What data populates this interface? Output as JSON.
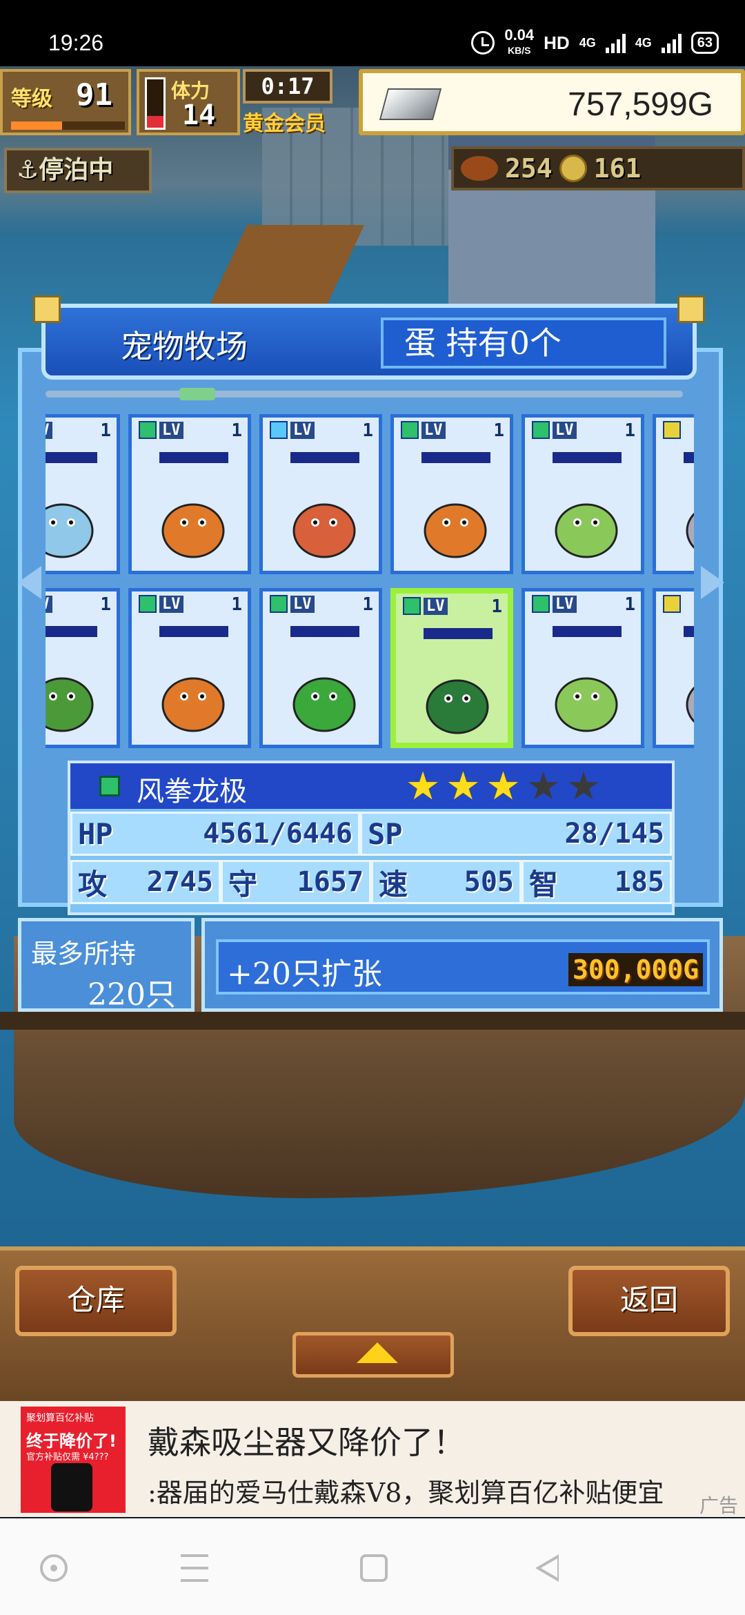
{
  "status_bar": {
    "time": "19:26",
    "net_speed": "0.04",
    "net_unit": "KB/S",
    "hd": "HD",
    "sig1": "4G",
    "sig2": "4G",
    "battery": "63"
  },
  "hud": {
    "level_label": "等级",
    "level": "91",
    "level_progress": 0.45,
    "stamina_label": "体力",
    "stamina": "14",
    "stamina_fill": 0.25,
    "timer": "0:17",
    "membership": "黄金会员",
    "gold": "757,599G",
    "status": "停泊中",
    "food": "254",
    "medals": "161",
    "icons": [
      "ingot-icon",
      "anchor-icon",
      "meat-icon",
      "coin-icon"
    ]
  },
  "pet_ranch": {
    "title": "宠物牧场",
    "eggs": "蛋 持有0个",
    "row1": [
      {
        "lv": "LV",
        "num": "1",
        "elem_color": "#4aa6e8",
        "pet": "ice-lizard-pet"
      },
      {
        "lv": "LV",
        "num": "1",
        "elem_color": "#2ec06a",
        "pet": "orange-bird-pet"
      },
      {
        "lv": "LV",
        "num": "1",
        "elem_color": "#5ac8ff",
        "pet": "octopus-pet"
      },
      {
        "lv": "LV",
        "num": "1",
        "elem_color": "#2ec06a",
        "pet": "orange-bird-pet"
      },
      {
        "lv": "LV",
        "num": "1",
        "elem_color": "#2ec06a",
        "pet": "green-frog-pet"
      },
      {
        "lv": "",
        "num": "",
        "elem_color": "#e8d23a",
        "pet": "partial-pet"
      }
    ],
    "row2": [
      {
        "lv": "LV",
        "num": "1",
        "elem_color": "#2ec06a",
        "pet": "pineapple-pet"
      },
      {
        "lv": "LV",
        "num": "1",
        "elem_color": "#2ec06a",
        "pet": "orange-bird-pet"
      },
      {
        "lv": "LV",
        "num": "1",
        "elem_color": "#2ec06a",
        "pet": "broccoli-pet"
      },
      {
        "lv": "LV",
        "num": "1",
        "elem_color": "#2ec06a",
        "pet": "wind-dragon-pet",
        "selected": true
      },
      {
        "lv": "LV",
        "num": "1",
        "elem_color": "#2ec06a",
        "pet": "green-frog-pet"
      },
      {
        "lv": "",
        "num": "",
        "elem_color": "#e8d23a",
        "pet": "partial-pet"
      }
    ]
  },
  "selected_pet": {
    "name": "风拳龙极",
    "stars": 3,
    "max_stars": 5,
    "hp_label": "HP",
    "hp": "4561/6446",
    "sp_label": "SP",
    "sp": "28/145",
    "atk_label": "攻",
    "atk": "2745",
    "def_label": "守",
    "def": "1657",
    "spd_label": "速",
    "spd": "505",
    "int_label": "智",
    "int": "185"
  },
  "capacity": {
    "label": "最多所持",
    "value": "220只"
  },
  "expand": {
    "label": "+20只扩张",
    "cost": "300,000G"
  },
  "buttons": {
    "warehouse": "仓库",
    "back": "返回"
  },
  "ad": {
    "img_top": "聚划算百亿补贴",
    "img_headline": "终于降价了!",
    "img_sub": "官方补贴仅需 ¥4???",
    "title": "戴森吸尘器又降价了！",
    "subtitle": ":器届的爱马仕戴森V8，聚划算百亿补贴便宜",
    "tag": "广告"
  }
}
